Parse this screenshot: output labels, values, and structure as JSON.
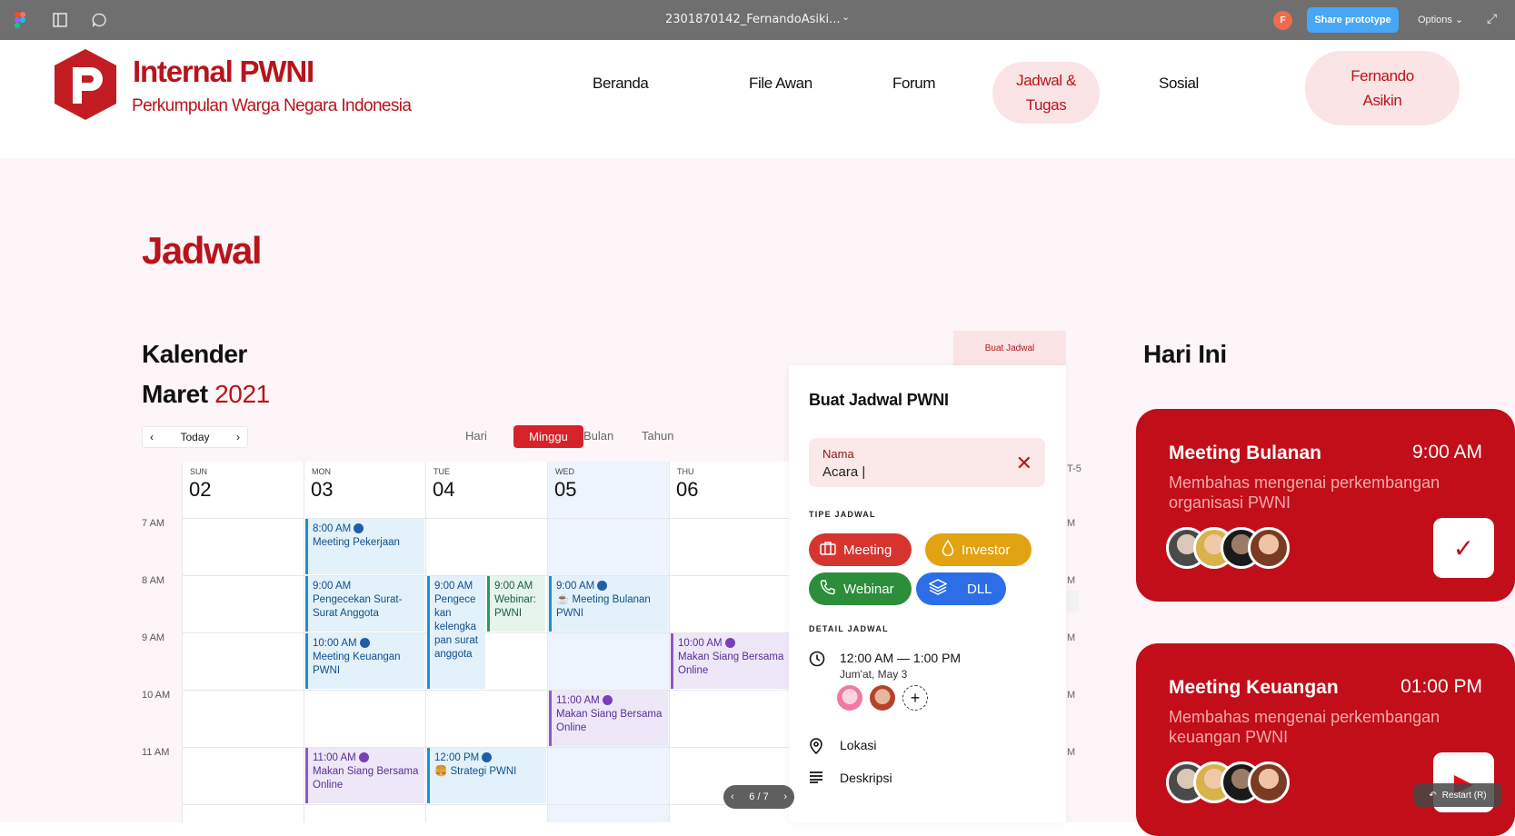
{
  "topbar": {
    "file_title": "2301870142_FernandoAsiki...",
    "avatar_initial": "F",
    "share_label": "Share prototype",
    "options_label": "Options"
  },
  "header": {
    "brand_title": "Internal PWNI",
    "brand_sub": "Perkumpulan Warga Negara Indonesia",
    "nav": [
      "Beranda",
      "File Awan",
      "Forum",
      "Jadwal &\nTugas",
      "Sosial"
    ],
    "user": "Fernando\nAsikin",
    "brand_color": "#b8141c"
  },
  "page": {
    "title": "Jadwal",
    "calendar_title": "Kalender",
    "month": "Maret",
    "year": "2021",
    "today_title": "Hari Ini"
  },
  "calendar": {
    "today_btn": "Today",
    "views": [
      "Hari",
      "Minggu",
      "Bulan",
      "Tahun"
    ],
    "active_view": "Minggu",
    "days": [
      {
        "label": "SUN",
        "num": "02"
      },
      {
        "label": "MON",
        "num": "03"
      },
      {
        "label": "TUE",
        "num": "04"
      },
      {
        "label": "WED",
        "num": "05"
      },
      {
        "label": "THU",
        "num": "06"
      }
    ],
    "hours": [
      "7 AM",
      "8 AM",
      "9 AM",
      "10 AM",
      "11 AM"
    ],
    "events": [
      {
        "time": "8:00 AM",
        "title": "Meeting Pekerjaan",
        "color": "blue"
      },
      {
        "time": "9:00 AM",
        "title": "Pengecekan Surat-Surat Anggota",
        "color": "blue"
      },
      {
        "time": "10:00 AM",
        "title": "Meeting Keuangan PWNI",
        "color": "blue"
      },
      {
        "time": "11:00 AM",
        "title": "Makan Siang Bersama Online",
        "color": "purple"
      },
      {
        "time": "9:00 AM",
        "title": "Pengece kan kelengka pan surat anggota",
        "color": "blue"
      },
      {
        "time": "9:00 AM",
        "title": "Webinar: PWNI",
        "color": "green"
      },
      {
        "time": "12:00 PM",
        "title": "🍔 Strategi PWNI",
        "color": "blue"
      },
      {
        "time": "9:00 AM",
        "title": "☕ Meeting Bulanan PWNI",
        "color": "blue"
      },
      {
        "time": "11:00 AM",
        "title": "Makan Siang Bersama Online",
        "color": "purple"
      },
      {
        "time": "10:00 AM",
        "title": "Makan Siang Bersama Online",
        "color": "purple"
      }
    ],
    "pager": "6 / 7"
  },
  "create_panel": {
    "tab_label": "Buat Jadwal",
    "title": "Buat Jadwal PWNI",
    "name_label": "Nama",
    "name_value": "Acara |",
    "type_heading": "TIPE JADWAL",
    "types": [
      {
        "label": "Meeting",
        "color": "#d6342f"
      },
      {
        "label": "Investor",
        "color": "#e2a312"
      },
      {
        "label": "Webinar",
        "color": "#2c8d3a"
      },
      {
        "label": "DLL",
        "color": "#2d6ee8"
      }
    ],
    "detail_heading": "DETAIL JADWAL",
    "time_range": "12:00 AM — 1:00 PM",
    "date_text": "Jum'at, May 3",
    "location_label": "Lokasi",
    "description_label": "Deskripsi"
  },
  "today": [
    {
      "title": "Meeting Bulanan",
      "time": "9:00 AM",
      "desc": "Membahas mengenai perkembangan organisasi PWNI"
    },
    {
      "title": "Meeting Keuangan",
      "time": "01:00 PM",
      "desc": "Membahas mengenai perkembangan keuangan PWNI"
    }
  ],
  "restart_label": "Restart (R)",
  "edge_labels": [
    "T-5",
    "M",
    "M",
    "M",
    "M",
    "M"
  ]
}
